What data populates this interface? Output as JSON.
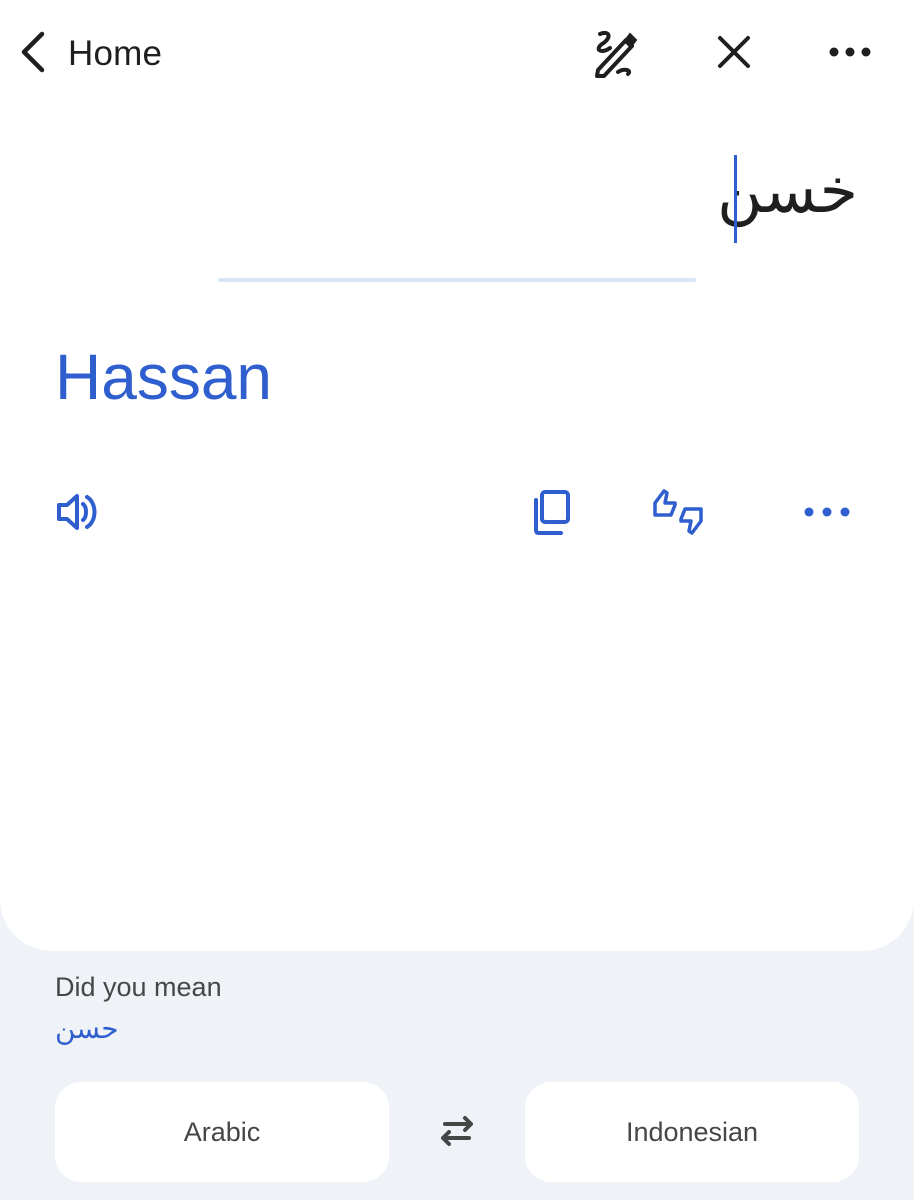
{
  "header": {
    "back_label": "Home",
    "icons": [
      "back-arrow-icon",
      "handwriting-icon",
      "close-icon",
      "more-options-icon"
    ]
  },
  "source": {
    "text": "خسن"
  },
  "translation": {
    "text": "Hassan",
    "actions": [
      "speaker-icon",
      "copy-icon",
      "feedback-thumbs-icon",
      "more-options-icon"
    ]
  },
  "suggestion": {
    "label": "Did you mean",
    "value": "حسن"
  },
  "languages": {
    "source": "Arabic",
    "target": "Indonesian",
    "swap_icon": "swap-arrows-icon"
  },
  "colors": {
    "accent": "#2f5fce",
    "card_bg": "#ffffff",
    "page_bg": "#eff3f8",
    "divider": "#d7e6f7"
  }
}
